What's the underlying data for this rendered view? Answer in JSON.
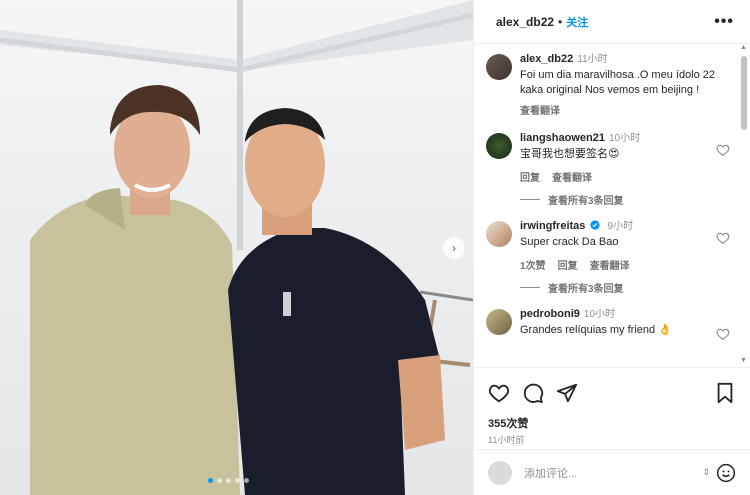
{
  "header": {
    "username": "alex_db22",
    "dot": "•",
    "follow_label": "关注",
    "more_label": "•••"
  },
  "caption": {
    "username": "alex_db22",
    "time": "11小时",
    "text": "Foi um dia maravilhosa .O meu ídolo 22 kaka original Nos vemos em beijing !",
    "translate": "查看翻译"
  },
  "comments": [
    {
      "username": "liangshaowen21",
      "time": "10小时",
      "text": "宝哥我也想要签名😍",
      "actions": [
        "回复",
        "查看翻译"
      ],
      "replies": "查看所有3条回复"
    },
    {
      "username": "irwingfreitas",
      "verified": true,
      "time": "9小时",
      "text": "Super crack Da Bao",
      "actions": [
        "1次赞",
        "回复",
        "查看翻译"
      ],
      "replies": "查看所有3条回复"
    },
    {
      "username": "pedroboni9",
      "time": "10小时",
      "text": "Grandes relíquias my friend 👌",
      "actions": []
    }
  ],
  "likes": "355次赞",
  "posted_ago": "11小时前",
  "add_comment_placeholder": "添加评论...",
  "media": {
    "carousel_dots": 5,
    "active_dot": 0,
    "next_label": "›"
  },
  "colors": {
    "accent": "#0095f6",
    "secondary_text": "#8e8e8e"
  }
}
